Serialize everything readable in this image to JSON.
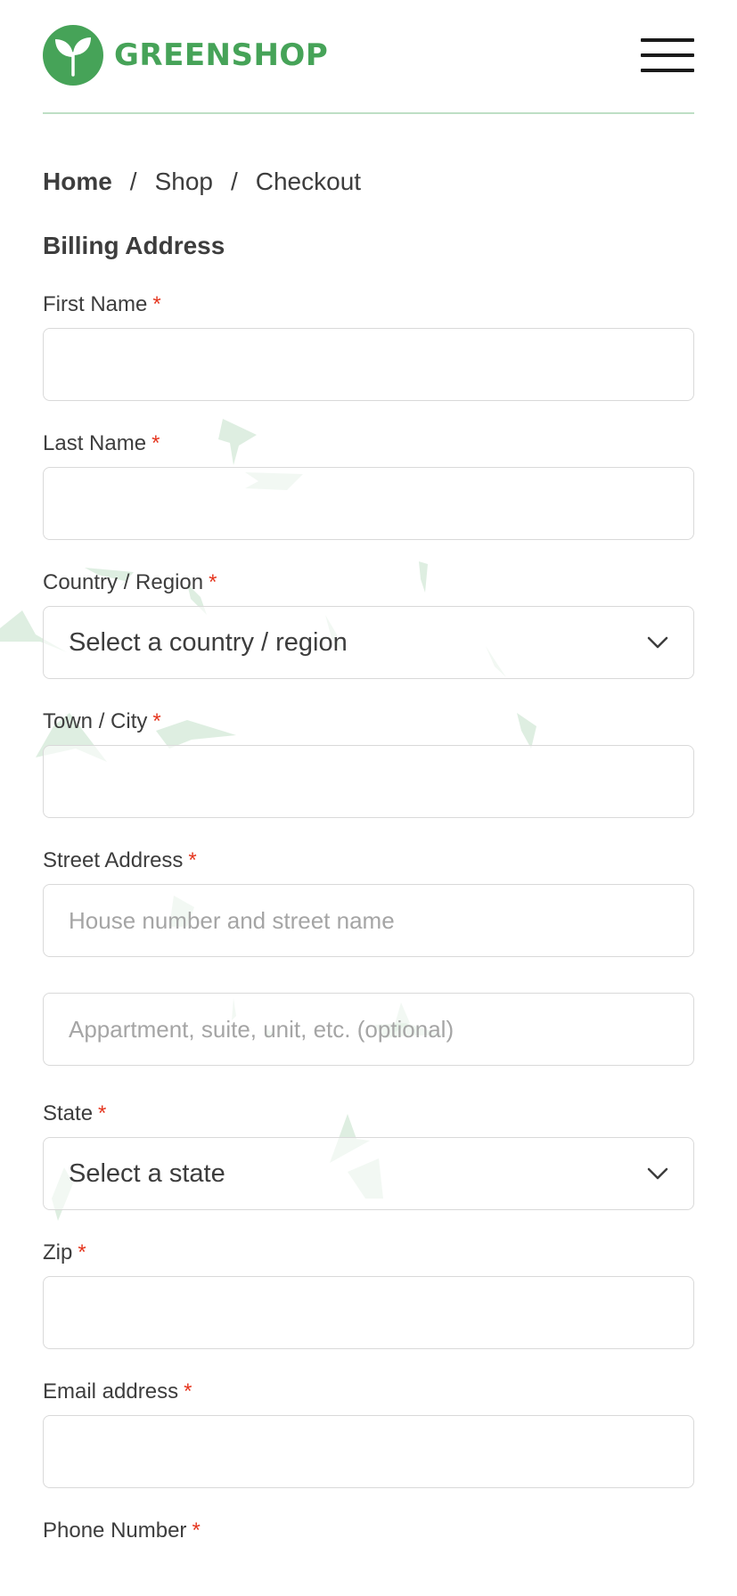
{
  "brand": {
    "name": "GREENSHOP",
    "color": "#46a358"
  },
  "breadcrumb": {
    "items": [
      "Home",
      "Shop",
      "Checkout"
    ],
    "separator": "/"
  },
  "section_title": "Billing Address",
  "required_marker": "*",
  "form": {
    "first_name": {
      "label": "First Name",
      "value": "",
      "placeholder": ""
    },
    "last_name": {
      "label": "Last Name",
      "value": "",
      "placeholder": ""
    },
    "country": {
      "label": "Country / Region",
      "selected": "Select a country / region"
    },
    "town": {
      "label": "Town / City",
      "value": "",
      "placeholder": ""
    },
    "street": {
      "label": "Street Address",
      "placeholder": "House number and street name",
      "placeholder2": "Appartment, suite, unit, etc. (optional)"
    },
    "state": {
      "label": "State",
      "selected": "Select a state"
    },
    "zip": {
      "label": "Zip",
      "value": "",
      "placeholder": ""
    },
    "email": {
      "label": "Email address",
      "value": "",
      "placeholder": ""
    },
    "phone": {
      "label": "Phone Number"
    }
  },
  "colors": {
    "accent": "#46a358",
    "required": "#e5361f",
    "border": "#d9d9d9",
    "text": "#3d3d3d"
  },
  "icons": {
    "logo": "leaf-logo-icon",
    "menu": "hamburger-menu-icon",
    "dropdown": "chevron-down-icon"
  }
}
